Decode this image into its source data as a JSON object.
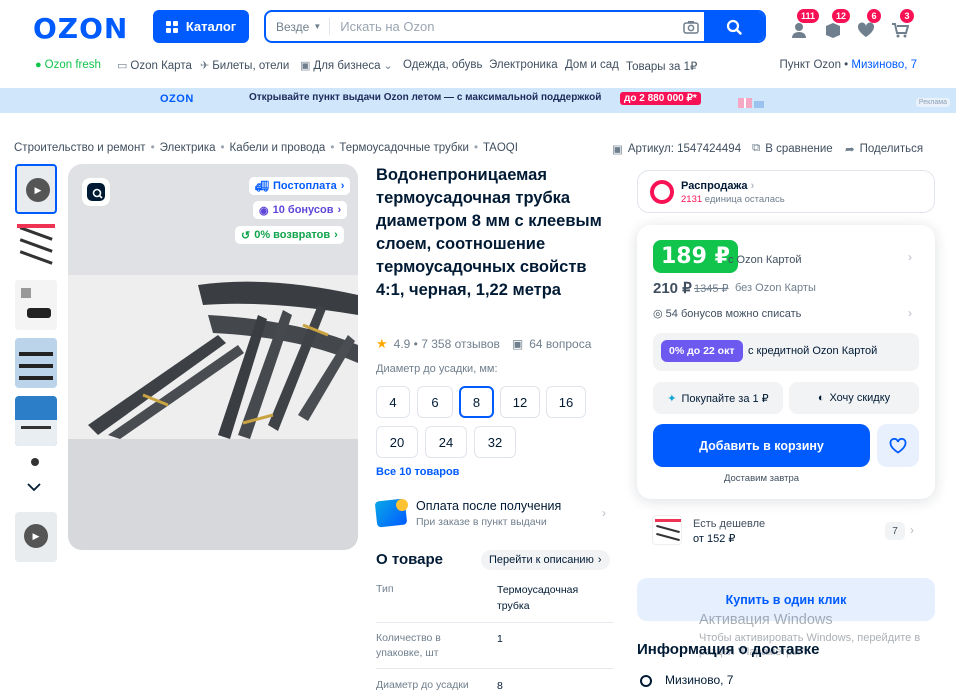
{
  "header": {
    "logo": "OZON",
    "catalog_label": "Каталог",
    "search_scope": "Везде",
    "search_placeholder": "Искать на Ozon",
    "badges": [
      "111",
      "12",
      "6",
      "3"
    ]
  },
  "nav": {
    "items": [
      "Ozon fresh",
      "Ozon Карта",
      "Билеты, отели",
      "Для бизнеса",
      "Одежда, обувь",
      "Электроника",
      "Дом и сад",
      "Товары за 1₽"
    ],
    "pickup_label": "Пункт Ozon •",
    "pickup_value": "Мизиново, 7"
  },
  "banner": {
    "logo": "OZON",
    "text": "Открывайте пункт выдачи Ozon летом — с максимальной поддержкой",
    "price": "до 2 880 000 ₽*",
    "ad": "Реклама"
  },
  "breadcrumbs": [
    "Строительство и ремонт",
    "Электрика",
    "Кабели и провода",
    "Термоусадочные трубки",
    "TAOQI"
  ],
  "meta": {
    "article": "Артикул: 1547424494",
    "compare": "В сравнение",
    "share": "Поделиться"
  },
  "gallery": {
    "pills": [
      "Постоплата",
      "10 бонусов",
      "0% возвратов"
    ]
  },
  "product": {
    "title": "Водонепроницаемая термоусадочная трубка диаметром 8 мм с клеевым слоем, соотношение термоусадочных свойств 4:1, черная, 1,22 метра",
    "rating": "4.9 • 7 358 отзывов",
    "questions": "64 вопроса",
    "diameter_label": "Диаметр до усадки, мм:",
    "diameters": [
      "4",
      "6",
      "8",
      "12",
      "16",
      "20",
      "24",
      "32"
    ],
    "selected_diameter": "8",
    "all_link": "Все 10 товаров",
    "pay_title": "Оплата после получения",
    "pay_sub": "При заказе в пункт выдачи",
    "about_title": "О товаре",
    "about_link": "Перейти к описанию",
    "specs": [
      {
        "key": "Тип",
        "value": "Термоусадочная трубка"
      },
      {
        "key": "Количество в упаковке, шт",
        "value": "1"
      },
      {
        "key": "Диаметр до усадки",
        "value": "8"
      }
    ]
  },
  "sale": {
    "title": "Распродажа",
    "count": "2131",
    "count_suffix": "единица осталась"
  },
  "price": {
    "card_price": "189 ₽",
    "card_label": "с Ozon Картой",
    "price": "210 ₽",
    "old_price": "1345 ₽",
    "price_label": "без Ozon Карты",
    "bonus": "54 бонусов можно списать",
    "credit_pill": "0% до 22 окт",
    "credit_label": "с кредитной Ozon Картой",
    "buy_for_1": "Покупайте за 1 ₽",
    "want_discount": "Хочу скидку",
    "add_to_cart": "Добавить в корзину",
    "delivery": "Доставим завтра"
  },
  "cheaper": {
    "line1": "Есть дешевле",
    "line2": "от 152 ₽",
    "count": "7"
  },
  "one_click": "Купить в один клик",
  "delivery_info": {
    "title": "Информация о доставке",
    "address": "Мизиново, 7"
  },
  "watermark": {
    "line1": "Активация Windows",
    "line2": "Чтобы активировать Windows, перейдите в",
    "line3": "раздел \"Параметры\"."
  },
  "colors": {
    "brand": "#005bff",
    "price_green": "#10c44c",
    "sale_pink": "#f91155",
    "credit_purple": "#6d58f0"
  }
}
